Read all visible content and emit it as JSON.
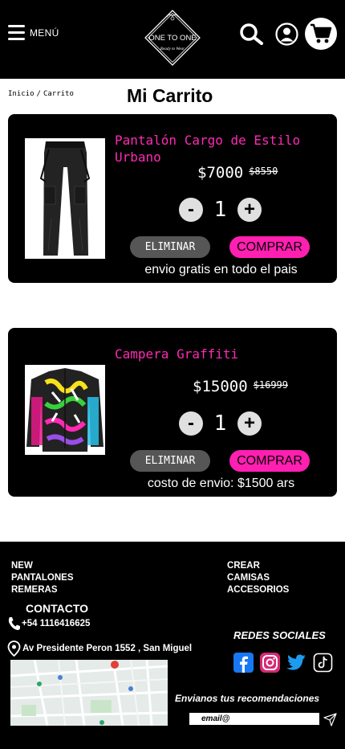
{
  "header": {
    "menu_label": "MENÚ",
    "logo_text": "ONE TO ONE",
    "logo_tagline": "Ready to Wear",
    "icons": [
      "hamburger-icon",
      "search-icon",
      "user-icon",
      "cart-icon"
    ]
  },
  "breadcrumb": {
    "home": "Inicio",
    "separator": "/",
    "current": "Carrito"
  },
  "page_title": "Mi Carrito",
  "cart": {
    "items": [
      {
        "name": "Pantalón Cargo de Estilo Urbano",
        "price": "$7000",
        "old_price": "$8550",
        "quantity": "1",
        "remove_label": "ELIMINAR",
        "buy_label": "COMPRAR",
        "shipping": "envio gratis en todo el pais"
      },
      {
        "name": "Campera Graffiti",
        "price": "$15000",
        "old_price": "$16999",
        "quantity": "1",
        "remove_label": "ELIMINAR",
        "buy_label": "COMPRAR",
        "shipping": "costo de envio: $1500 ars"
      }
    ],
    "minus_symbol": "-",
    "plus_symbol": "+"
  },
  "footer": {
    "categories_left": [
      "NEW",
      "PANTALONES",
      "REMERAS"
    ],
    "categories_right": [
      "CREAR",
      "CAMISAS",
      "ACCESORIOS"
    ],
    "contact_title": "CONTACTO",
    "phone": "+54 1116416625",
    "address": "Av Presidente Peron 1552 , San Miguel",
    "social_title": "REDES SOCIALES",
    "social_icons": [
      "facebook-icon",
      "instagram-icon",
      "twitter-icon",
      "tiktok-icon"
    ],
    "recommendations_title": "Envianos tus recomendaciones",
    "email_placeholder": "email@"
  },
  "colors": {
    "accent_pink": "#ff1fb1",
    "product_name_pink": "#ff2ab3",
    "card_background": "#000000",
    "remove_button": "#565656"
  }
}
